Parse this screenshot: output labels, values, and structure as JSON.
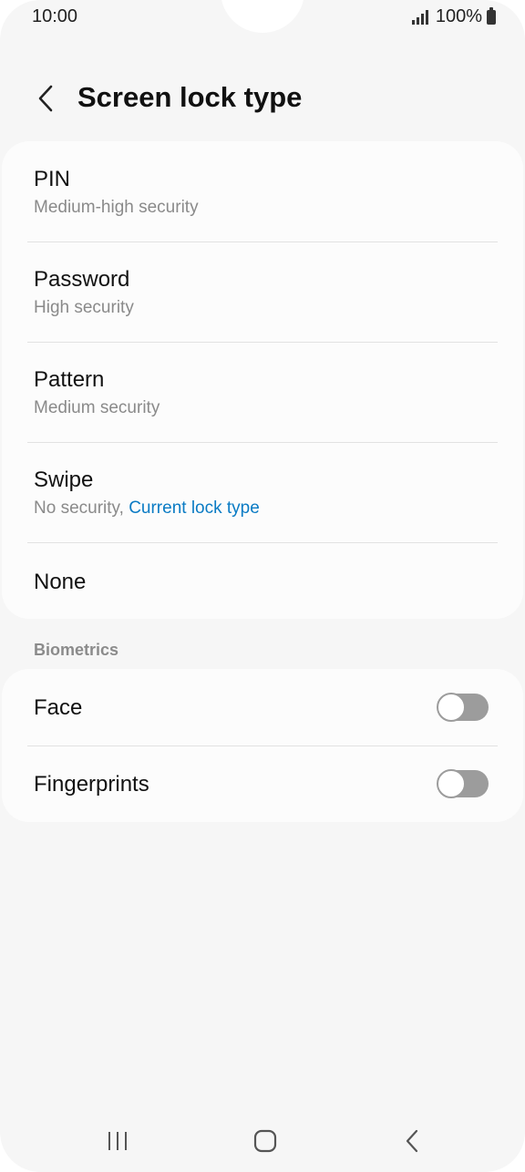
{
  "status": {
    "time": "10:00",
    "battery": "100%"
  },
  "header": {
    "title": "Screen lock type"
  },
  "lock_types": [
    {
      "title": "PIN",
      "subtitle": "Medium-high security"
    },
    {
      "title": "Password",
      "subtitle": "High security"
    },
    {
      "title": "Pattern",
      "subtitle": "Medium security"
    },
    {
      "title": "Swipe",
      "subtitle": "No security, ",
      "subtitle_accent": "Current lock type"
    },
    {
      "title": "None"
    }
  ],
  "biometrics": {
    "label": "Biometrics",
    "items": [
      {
        "title": "Face",
        "enabled": false
      },
      {
        "title": "Fingerprints",
        "enabled": false
      }
    ]
  },
  "colors": {
    "accent": "#0a7bc4",
    "background": "#f6f6f6",
    "card": "#fcfcfc",
    "toggle_off": "#9c9c9c"
  },
  "navbar": {
    "icons": [
      "recent-apps-icon",
      "home-icon",
      "back-icon"
    ]
  }
}
